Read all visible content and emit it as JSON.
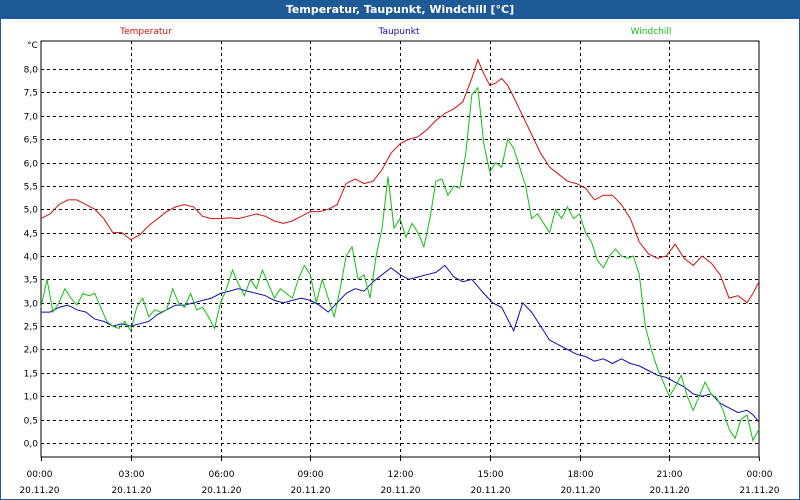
{
  "window": {
    "title": "Temperatur, Taupunkt, Windchill [°C]"
  },
  "chart_data": {
    "type": "line",
    "title": "Temperatur, Taupunkt, Windchill [°C]",
    "ylabel": "°C",
    "ylim": [
      -0.3,
      8.6
    ],
    "xlim": [
      0,
      24
    ],
    "grid": true,
    "y_ticks": [
      0.0,
      0.5,
      1.0,
      1.5,
      2.0,
      2.5,
      3.0,
      3.5,
      4.0,
      4.5,
      5.0,
      5.5,
      6.0,
      6.5,
      7.0,
      7.5,
      8.0
    ],
    "y_tick_labels": [
      "0,0",
      "0,5",
      "1,0",
      "1,5",
      "2,0",
      "2,5",
      "3,0",
      "3,5",
      "4,0",
      "4,5",
      "5,0",
      "5,5",
      "6,0",
      "6,5",
      "7,0",
      "7,5",
      "8,0"
    ],
    "x_ticks": [
      {
        "hour": 0,
        "time": "00:00",
        "date": "20.11.20"
      },
      {
        "hour": 3,
        "time": "03:00",
        "date": "20.11.20"
      },
      {
        "hour": 6,
        "time": "06:00",
        "date": "20.11.20"
      },
      {
        "hour": 9,
        "time": "09:00",
        "date": "20.11.20"
      },
      {
        "hour": 12,
        "time": "12:00",
        "date": "20.11.20"
      },
      {
        "hour": 15,
        "time": "15:00",
        "date": "20.11.20"
      },
      {
        "hour": 18,
        "time": "18:00",
        "date": "20.11.20"
      },
      {
        "hour": 21,
        "time": "21:00",
        "date": "20.11.20"
      },
      {
        "hour": 24,
        "time": "00:00",
        "date": "21.11.20"
      }
    ],
    "series": [
      {
        "name": "Temperatur",
        "color": "#d01010",
        "legend_position": "left",
        "points": [
          [
            0,
            4.8
          ],
          [
            0.3,
            4.9
          ],
          [
            0.6,
            5.1
          ],
          [
            0.9,
            5.2
          ],
          [
            1.2,
            5.2
          ],
          [
            1.5,
            5.1
          ],
          [
            1.8,
            5.0
          ],
          [
            2.1,
            4.8
          ],
          [
            2.4,
            4.5
          ],
          [
            2.7,
            4.5
          ],
          [
            3.0,
            4.35
          ],
          [
            3.3,
            4.45
          ],
          [
            3.6,
            4.65
          ],
          [
            3.9,
            4.8
          ],
          [
            4.2,
            4.95
          ],
          [
            4.5,
            5.05
          ],
          [
            4.8,
            5.1
          ],
          [
            5.1,
            5.05
          ],
          [
            5.4,
            4.85
          ],
          [
            5.7,
            4.8
          ],
          [
            6.0,
            4.8
          ],
          [
            6.3,
            4.82
          ],
          [
            6.6,
            4.8
          ],
          [
            6.9,
            4.85
          ],
          [
            7.2,
            4.9
          ],
          [
            7.5,
            4.85
          ],
          [
            7.8,
            4.75
          ],
          [
            8.1,
            4.7
          ],
          [
            8.4,
            4.75
          ],
          [
            8.7,
            4.85
          ],
          [
            9.0,
            4.95
          ],
          [
            9.3,
            4.95
          ],
          [
            9.6,
            5.0
          ],
          [
            9.9,
            5.1
          ],
          [
            10.2,
            5.55
          ],
          [
            10.5,
            5.65
          ],
          [
            10.8,
            5.55
          ],
          [
            11.1,
            5.6
          ],
          [
            11.4,
            5.85
          ],
          [
            11.7,
            6.2
          ],
          [
            12.0,
            6.4
          ],
          [
            12.3,
            6.5
          ],
          [
            12.6,
            6.55
          ],
          [
            12.9,
            6.7
          ],
          [
            13.2,
            6.9
          ],
          [
            13.5,
            7.05
          ],
          [
            13.8,
            7.15
          ],
          [
            14.1,
            7.3
          ],
          [
            14.4,
            7.8
          ],
          [
            14.6,
            8.2
          ],
          [
            14.8,
            7.9
          ],
          [
            15.0,
            7.65
          ],
          [
            15.2,
            7.7
          ],
          [
            15.4,
            7.8
          ],
          [
            15.6,
            7.65
          ],
          [
            15.8,
            7.4
          ],
          [
            16.1,
            7.0
          ],
          [
            16.4,
            6.6
          ],
          [
            16.7,
            6.2
          ],
          [
            17.0,
            5.9
          ],
          [
            17.3,
            5.75
          ],
          [
            17.6,
            5.6
          ],
          [
            17.9,
            5.55
          ],
          [
            18.2,
            5.45
          ],
          [
            18.5,
            5.2
          ],
          [
            18.8,
            5.3
          ],
          [
            19.1,
            5.3
          ],
          [
            19.4,
            5.1
          ],
          [
            19.7,
            4.8
          ],
          [
            20.0,
            4.3
          ],
          [
            20.3,
            4.05
          ],
          [
            20.6,
            3.95
          ],
          [
            20.9,
            4.0
          ],
          [
            21.2,
            4.25
          ],
          [
            21.5,
            3.95
          ],
          [
            21.8,
            3.8
          ],
          [
            22.1,
            4.0
          ],
          [
            22.4,
            3.85
          ],
          [
            22.7,
            3.6
          ],
          [
            23.0,
            3.1
          ],
          [
            23.3,
            3.15
          ],
          [
            23.6,
            3.0
          ],
          [
            23.8,
            3.2
          ],
          [
            24.0,
            3.45
          ]
        ]
      },
      {
        "name": "Taupunkt",
        "color": "#1010b0",
        "legend_position": "center",
        "points": [
          [
            0,
            2.8
          ],
          [
            0.3,
            2.8
          ],
          [
            0.6,
            2.9
          ],
          [
            0.9,
            2.95
          ],
          [
            1.2,
            2.85
          ],
          [
            1.5,
            2.8
          ],
          [
            1.8,
            2.65
          ],
          [
            2.1,
            2.6
          ],
          [
            2.4,
            2.5
          ],
          [
            2.7,
            2.55
          ],
          [
            3.0,
            2.5
          ],
          [
            3.3,
            2.55
          ],
          [
            3.6,
            2.6
          ],
          [
            3.9,
            2.75
          ],
          [
            4.2,
            2.85
          ],
          [
            4.5,
            2.95
          ],
          [
            4.8,
            2.95
          ],
          [
            5.1,
            3.0
          ],
          [
            5.4,
            3.05
          ],
          [
            5.7,
            3.1
          ],
          [
            6.0,
            3.2
          ],
          [
            6.3,
            3.25
          ],
          [
            6.6,
            3.3
          ],
          [
            6.9,
            3.25
          ],
          [
            7.2,
            3.2
          ],
          [
            7.5,
            3.15
          ],
          [
            7.8,
            3.05
          ],
          [
            8.1,
            3.0
          ],
          [
            8.4,
            3.05
          ],
          [
            8.7,
            3.1
          ],
          [
            9.0,
            3.05
          ],
          [
            9.3,
            2.95
          ],
          [
            9.6,
            2.8
          ],
          [
            9.9,
            3.0
          ],
          [
            10.2,
            3.2
          ],
          [
            10.5,
            3.3
          ],
          [
            10.8,
            3.25
          ],
          [
            11.1,
            3.45
          ],
          [
            11.4,
            3.6
          ],
          [
            11.7,
            3.75
          ],
          [
            12.0,
            3.6
          ],
          [
            12.3,
            3.5
          ],
          [
            12.6,
            3.55
          ],
          [
            12.9,
            3.6
          ],
          [
            13.2,
            3.65
          ],
          [
            13.5,
            3.8
          ],
          [
            13.8,
            3.55
          ],
          [
            14.1,
            3.45
          ],
          [
            14.4,
            3.5
          ],
          [
            14.6,
            3.35
          ],
          [
            14.8,
            3.2
          ],
          [
            15.1,
            3.0
          ],
          [
            15.4,
            2.9
          ],
          [
            15.6,
            2.65
          ],
          [
            15.8,
            2.4
          ],
          [
            16.1,
            3.0
          ],
          [
            16.4,
            2.8
          ],
          [
            16.7,
            2.5
          ],
          [
            17.0,
            2.2
          ],
          [
            17.3,
            2.1
          ],
          [
            17.6,
            2.0
          ],
          [
            17.9,
            1.9
          ],
          [
            18.2,
            1.85
          ],
          [
            18.5,
            1.75
          ],
          [
            18.8,
            1.8
          ],
          [
            19.1,
            1.7
          ],
          [
            19.4,
            1.8
          ],
          [
            19.7,
            1.7
          ],
          [
            20.0,
            1.65
          ],
          [
            20.3,
            1.55
          ],
          [
            20.6,
            1.45
          ],
          [
            20.9,
            1.4
          ],
          [
            21.2,
            1.3
          ],
          [
            21.5,
            1.2
          ],
          [
            21.8,
            1.05
          ],
          [
            22.1,
            1.0
          ],
          [
            22.4,
            1.05
          ],
          [
            22.7,
            0.85
          ],
          [
            23.0,
            0.75
          ],
          [
            23.3,
            0.65
          ],
          [
            23.6,
            0.7
          ],
          [
            23.8,
            0.6
          ],
          [
            24.0,
            0.45
          ]
        ]
      },
      {
        "name": "Windchill",
        "color": "#10c010",
        "legend_position": "right",
        "points": [
          [
            0,
            2.9
          ],
          [
            0.2,
            3.5
          ],
          [
            0.4,
            2.8
          ],
          [
            0.6,
            3.0
          ],
          [
            0.8,
            3.3
          ],
          [
            1.0,
            3.1
          ],
          [
            1.2,
            2.95
          ],
          [
            1.4,
            3.2
          ],
          [
            1.6,
            3.15
          ],
          [
            1.8,
            3.2
          ],
          [
            2.0,
            2.9
          ],
          [
            2.2,
            2.6
          ],
          [
            2.4,
            2.5
          ],
          [
            2.6,
            2.45
          ],
          [
            2.8,
            2.6
          ],
          [
            3.0,
            2.4
          ],
          [
            3.2,
            2.9
          ],
          [
            3.4,
            3.1
          ],
          [
            3.6,
            2.7
          ],
          [
            3.8,
            2.85
          ],
          [
            4.0,
            2.8
          ],
          [
            4.2,
            2.85
          ],
          [
            4.4,
            3.3
          ],
          [
            4.6,
            3.0
          ],
          [
            4.8,
            2.9
          ],
          [
            5.0,
            3.2
          ],
          [
            5.2,
            2.85
          ],
          [
            5.4,
            2.9
          ],
          [
            5.6,
            2.7
          ],
          [
            5.8,
            2.45
          ],
          [
            6.0,
            3.0
          ],
          [
            6.2,
            3.3
          ],
          [
            6.4,
            3.7
          ],
          [
            6.6,
            3.4
          ],
          [
            6.8,
            3.15
          ],
          [
            7.0,
            3.5
          ],
          [
            7.2,
            3.3
          ],
          [
            7.4,
            3.7
          ],
          [
            7.6,
            3.4
          ],
          [
            7.8,
            3.1
          ],
          [
            8.0,
            3.3
          ],
          [
            8.2,
            3.2
          ],
          [
            8.4,
            3.1
          ],
          [
            8.6,
            3.5
          ],
          [
            8.8,
            3.8
          ],
          [
            9.0,
            3.6
          ],
          [
            9.2,
            3.0
          ],
          [
            9.4,
            3.5
          ],
          [
            9.6,
            3.1
          ],
          [
            9.8,
            2.7
          ],
          [
            10.0,
            3.3
          ],
          [
            10.2,
            4.0
          ],
          [
            10.4,
            4.2
          ],
          [
            10.6,
            3.5
          ],
          [
            10.8,
            3.6
          ],
          [
            11.0,
            3.1
          ],
          [
            11.2,
            4.0
          ],
          [
            11.4,
            4.6
          ],
          [
            11.6,
            5.7
          ],
          [
            11.8,
            4.6
          ],
          [
            12.0,
            4.8
          ],
          [
            12.2,
            4.4
          ],
          [
            12.4,
            4.7
          ],
          [
            12.6,
            4.5
          ],
          [
            12.8,
            4.2
          ],
          [
            13.0,
            4.8
          ],
          [
            13.2,
            5.6
          ],
          [
            13.4,
            5.65
          ],
          [
            13.6,
            5.3
          ],
          [
            13.8,
            5.5
          ],
          [
            14.0,
            5.45
          ],
          [
            14.2,
            6.2
          ],
          [
            14.4,
            7.45
          ],
          [
            14.6,
            7.6
          ],
          [
            14.8,
            6.4
          ],
          [
            15.0,
            5.8
          ],
          [
            15.2,
            6.0
          ],
          [
            15.4,
            5.9
          ],
          [
            15.6,
            6.5
          ],
          [
            15.8,
            6.3
          ],
          [
            16.0,
            5.9
          ],
          [
            16.2,
            5.5
          ],
          [
            16.4,
            4.8
          ],
          [
            16.6,
            4.9
          ],
          [
            16.8,
            4.7
          ],
          [
            17.0,
            4.5
          ],
          [
            17.2,
            5.0
          ],
          [
            17.4,
            4.8
          ],
          [
            17.6,
            5.05
          ],
          [
            17.8,
            4.8
          ],
          [
            18.0,
            4.9
          ],
          [
            18.2,
            4.5
          ],
          [
            18.4,
            4.3
          ],
          [
            18.6,
            3.9
          ],
          [
            18.8,
            3.75
          ],
          [
            19.0,
            4.0
          ],
          [
            19.2,
            4.15
          ],
          [
            19.4,
            4.0
          ],
          [
            19.6,
            3.95
          ],
          [
            19.8,
            4.0
          ],
          [
            20.0,
            3.6
          ],
          [
            20.2,
            2.5
          ],
          [
            20.4,
            2.0
          ],
          [
            20.6,
            1.6
          ],
          [
            20.8,
            1.3
          ],
          [
            21.0,
            1.0
          ],
          [
            21.2,
            1.2
          ],
          [
            21.4,
            1.45
          ],
          [
            21.6,
            1.0
          ],
          [
            21.8,
            0.7
          ],
          [
            22.0,
            1.0
          ],
          [
            22.2,
            1.3
          ],
          [
            22.4,
            1.05
          ],
          [
            22.6,
            0.95
          ],
          [
            22.8,
            0.7
          ],
          [
            23.0,
            0.3
          ],
          [
            23.2,
            0.1
          ],
          [
            23.4,
            0.5
          ],
          [
            23.6,
            0.6
          ],
          [
            23.8,
            0.05
          ],
          [
            24.0,
            0.3
          ]
        ]
      }
    ]
  }
}
